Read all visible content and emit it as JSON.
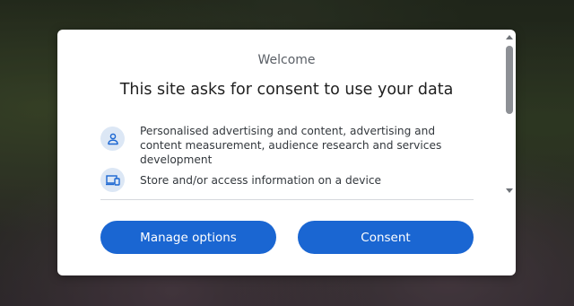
{
  "dialog": {
    "welcome_label": "Welcome",
    "headline": "This site asks for consent to use your data",
    "purposes": [
      {
        "icon": "person-icon",
        "text": "Personalised advertising and content, advertising and content measurement, audience research and services development"
      },
      {
        "icon": "devices-icon",
        "text": "Store and/or access information on a device"
      }
    ],
    "buttons": {
      "manage_label": "Manage options",
      "consent_label": "Consent"
    }
  },
  "colors": {
    "button_blue": "#1a66d2",
    "icon_circle": "#dce7f5",
    "icon_stroke": "#1a66d2"
  }
}
